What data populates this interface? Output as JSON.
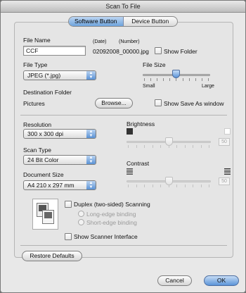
{
  "window": {
    "title": "Scan To File"
  },
  "tabs": {
    "software": "Software Button",
    "device": "Device Button"
  },
  "file": {
    "name_label": "File Name",
    "name_value": "CCF",
    "date_label": "(Date)",
    "number_label": "(Number)",
    "filename_preview": "02092008_00000.jpg",
    "show_folder_label": "Show Folder",
    "type_label": "File Type",
    "type_value": "JPEG (*.jpg)",
    "size_label": "File Size",
    "size_small": "Small",
    "size_large": "Large",
    "size_level": 0.5,
    "dest_label": "Destination Folder",
    "dest_value": "Pictures",
    "browse_label": "Browse...",
    "show_save_as_label": "Show Save As window"
  },
  "scan": {
    "resolution_label": "Resolution",
    "resolution_value": "300 x 300 dpi",
    "scan_type_label": "Scan Type",
    "scan_type_value": "24 Bit Color",
    "doc_size_label": "Document Size",
    "doc_size_value": "A4  210 x 297 mm",
    "brightness_label": "Brightness",
    "brightness_value": "50",
    "contrast_label": "Contrast",
    "contrast_value": "50",
    "duplex_label": "Duplex (two-sided) Scanning",
    "long_edge_label": "Long-edge binding",
    "short_edge_label": "Short-edge binding",
    "show_interface_label": "Show Scanner Interface"
  },
  "footer": {
    "restore_label": "Restore Defaults",
    "cancel_label": "Cancel",
    "ok_label": "OK"
  },
  "colors": {
    "accent": "#5b94d8",
    "window_bg": "#e8e8e8"
  }
}
